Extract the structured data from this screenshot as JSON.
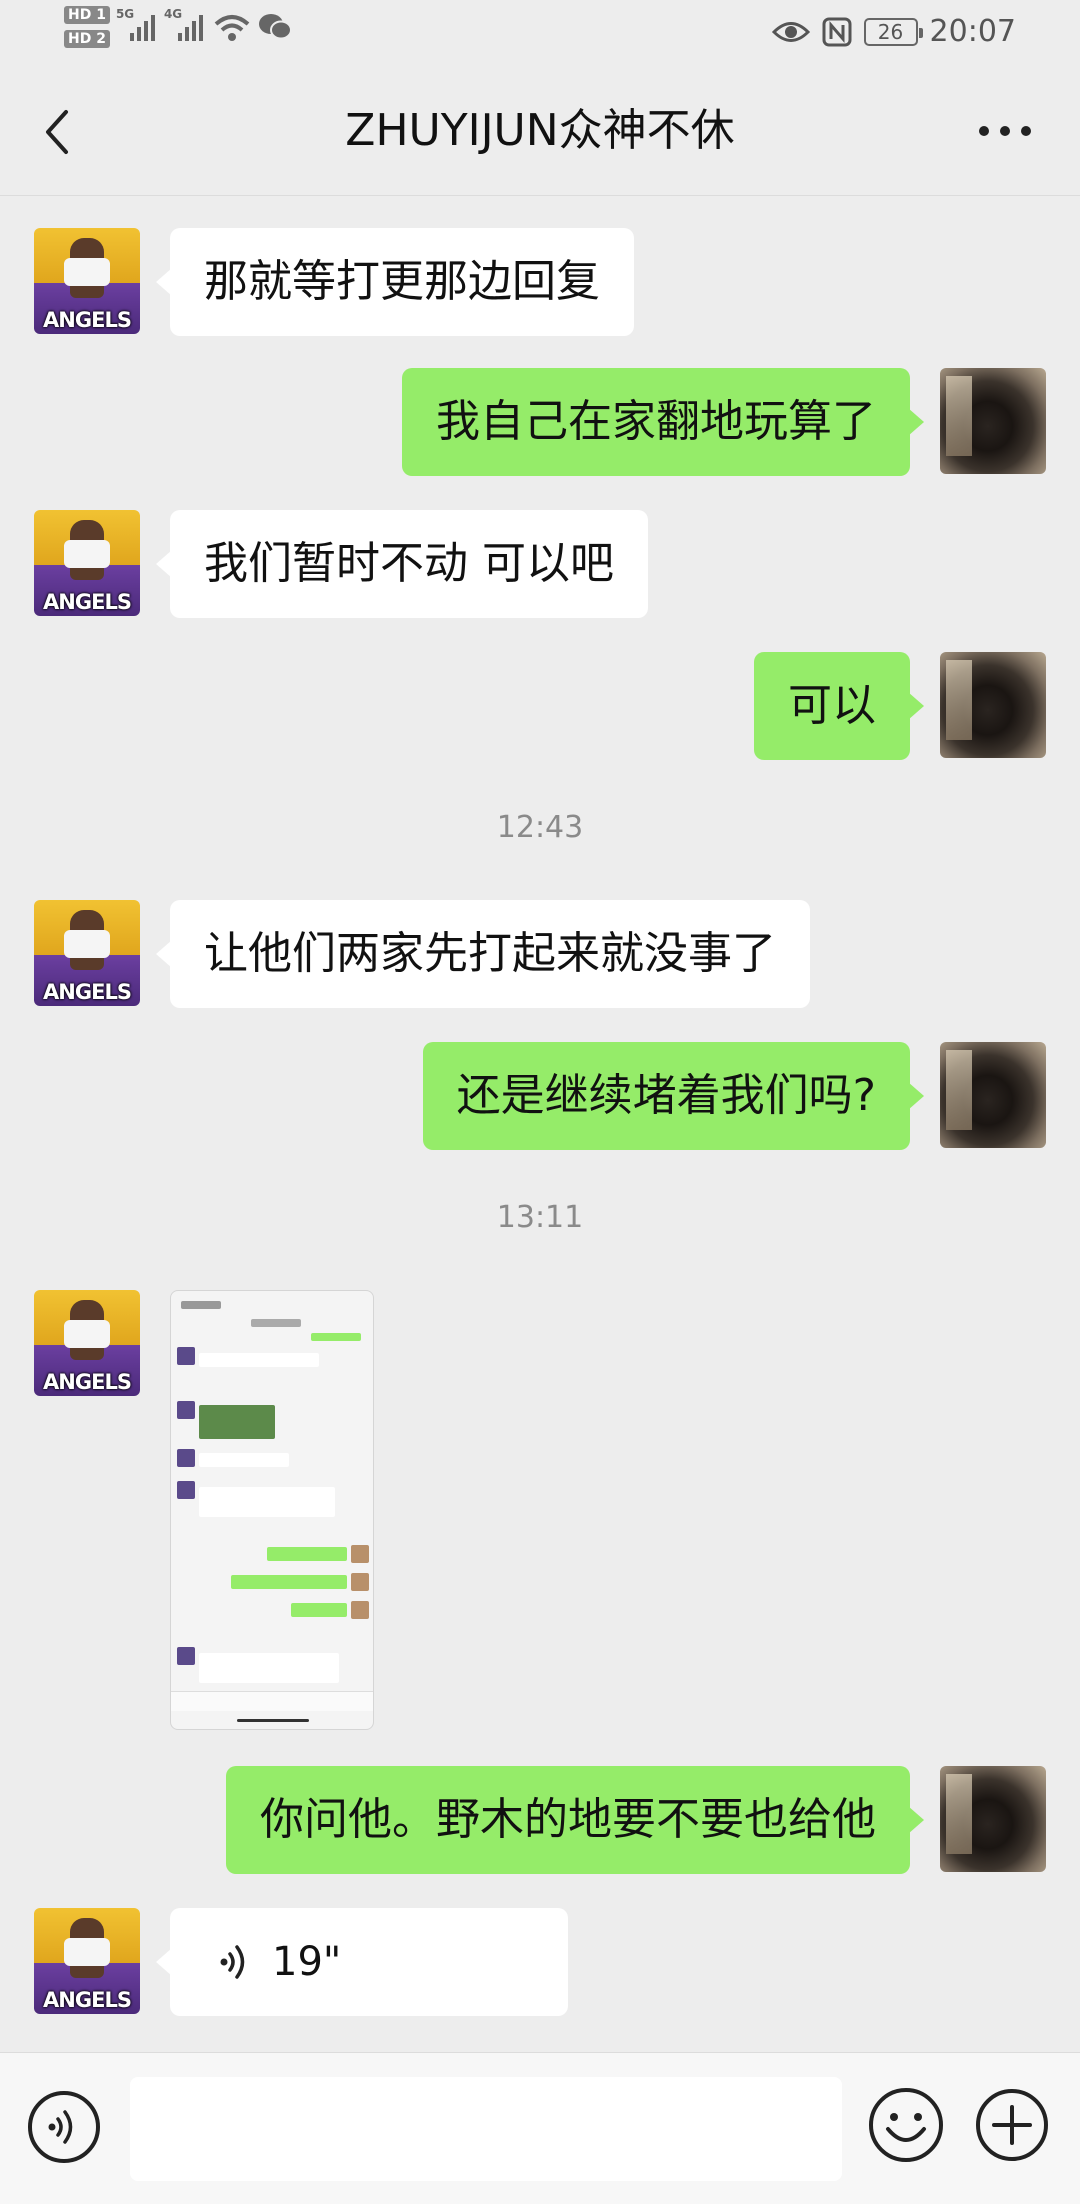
{
  "status_bar": {
    "hd1": "HD 1",
    "hd2": "HD 2",
    "net1": "5G",
    "net2": "4G",
    "battery": "26",
    "time": "20:07"
  },
  "header": {
    "title": "ZHUYIJUN众神不休"
  },
  "avatars": {
    "friend_text": "ANGELS"
  },
  "messages": [
    {
      "side": "in",
      "text": "那就等打更那边回复"
    },
    {
      "side": "out",
      "text": "我自己在家翻地玩算了"
    },
    {
      "side": "in",
      "text": "我们暂时不动 可以吧"
    },
    {
      "side": "out",
      "text": "可以"
    },
    {
      "side": "in",
      "text": "让他们两家先打起来就没事了"
    },
    {
      "side": "out",
      "text": "还是继续堵着我们吗?"
    },
    {
      "side": "in",
      "type": "image"
    },
    {
      "side": "out",
      "text": "你问他。野木的地要不要也给他"
    },
    {
      "side": "in",
      "type": "voice",
      "duration": "19\""
    }
  ],
  "timestamps": [
    "12:43",
    "13:11"
  ],
  "input_bar": {
    "placeholder": ""
  }
}
